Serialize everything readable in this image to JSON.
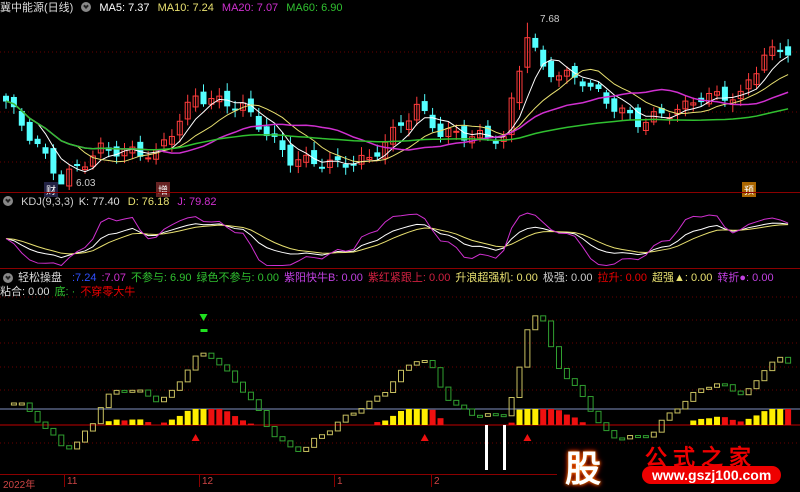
{
  "main": {
    "title": "冀中能源(日线)",
    "ma5": "MA5: 7.37",
    "ma10": "MA10: 7.24",
    "ma20": "MA20: 7.07",
    "ma60": "MA60: 6.90",
    "high_label": "7.68",
    "low_label": "6.03",
    "tags": [
      "财",
      "增",
      "预"
    ]
  },
  "kdj": {
    "title": "KDJ(9,3,3)",
    "k": "K: 77.40",
    "d": "D: 76.18",
    "j": "J: 79.82"
  },
  "indicator": {
    "title": "轻松操盘",
    "items": [
      ":7.24",
      ":7.07",
      "不参与: 6.90",
      "绿色不参与: 0.00",
      "紫阳快牛B: 0.00",
      "紫红紧跟上: 0.00",
      "升浪超强机: 0.00",
      "极强: 0.00",
      "拉升: 0.00",
      "超强▲: 0.00",
      "转折●: 0.00",
      "粘合: 0.00",
      "底: ·",
      "不穿零大牛"
    ]
  },
  "axis": {
    "labels": [
      "2022年",
      "11",
      "12",
      "1",
      "2"
    ]
  },
  "watermark": {
    "char": "股",
    "title": "公式之家",
    "url": "www.gszj100.com"
  },
  "colors": {
    "up": "#ff3c3c",
    "down": "#54ffff",
    "ma5": "#ffffff",
    "ma10": "#e8e070",
    "ma20": "#d030d0",
    "ma60": "#30c030"
  },
  "chart_data": {
    "type": "candlestick",
    "bars": 100,
    "price_keypoints": [
      [
        0,
        6.86
      ],
      [
        7,
        6.03
      ],
      [
        12,
        6.36
      ],
      [
        19,
        6.3
      ],
      [
        24,
        6.91
      ],
      [
        30,
        6.8
      ],
      [
        36,
        6.25
      ],
      [
        42,
        6.2
      ],
      [
        46,
        6.25
      ],
      [
        52,
        6.8
      ],
      [
        55,
        6.53
      ],
      [
        63,
        6.47
      ],
      [
        66,
        7.57
      ],
      [
        68,
        7.19
      ],
      [
        73,
        7.08
      ],
      [
        76,
        6.86
      ],
      [
        80,
        6.64
      ],
      [
        86,
        6.8
      ],
      [
        88,
        6.91
      ],
      [
        93,
        6.91
      ],
      [
        96,
        7.35
      ],
      [
        99,
        7.4
      ]
    ],
    "ylim": [
      5.95,
      7.75
    ]
  }
}
